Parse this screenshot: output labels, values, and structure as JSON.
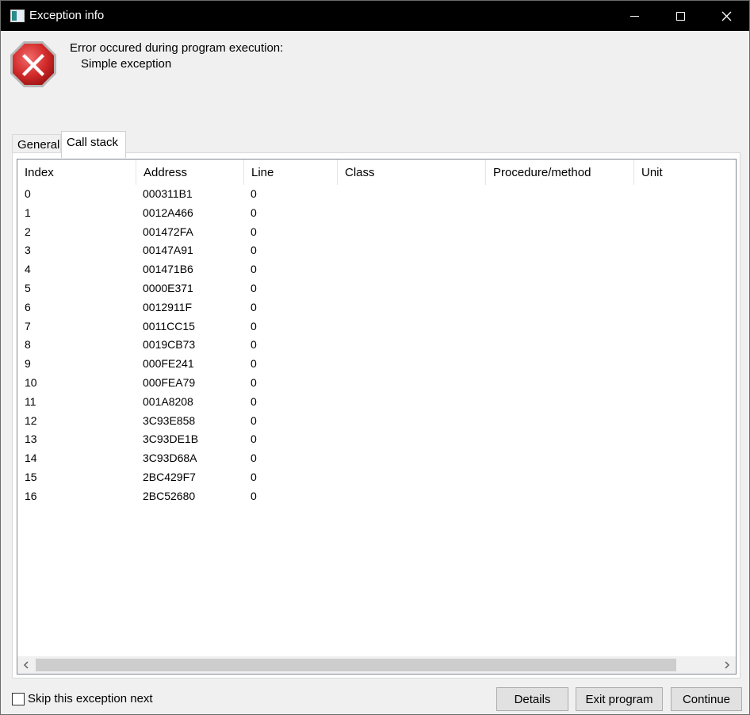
{
  "window": {
    "title": "Exception info",
    "icon": "app-window-icon",
    "controls": [
      "minimize-icon",
      "maximize-icon",
      "close-icon"
    ]
  },
  "message": {
    "icon": "error-icon",
    "line1": "Error occured during program execution:",
    "line2": "Simple exception"
  },
  "tabs": [
    {
      "label": "General",
      "active": false
    },
    {
      "label": "Call stack",
      "active": true
    }
  ],
  "table": {
    "columns": [
      "Index",
      "Address",
      "Line",
      "Class",
      "Procedure/method",
      "Unit"
    ],
    "rows": [
      [
        "0",
        "000311B1",
        "0"
      ],
      [
        "1",
        "0012A466",
        "0"
      ],
      [
        "2",
        "001472FA",
        "0"
      ],
      [
        "3",
        "00147A91",
        "0"
      ],
      [
        "4",
        "001471B6",
        "0"
      ],
      [
        "5",
        "0000E371",
        "0"
      ],
      [
        "6",
        "0012911F",
        "0"
      ],
      [
        "7",
        "0011CC15",
        "0"
      ],
      [
        "8",
        "0019CB73",
        "0"
      ],
      [
        "9",
        "000FE241",
        "0"
      ],
      [
        "10",
        "000FEA79",
        "0"
      ],
      [
        "11",
        "001A8208",
        "0"
      ],
      [
        "12",
        "3C93E858",
        "0"
      ],
      [
        "13",
        "3C93DE1B",
        "0"
      ],
      [
        "14",
        "3C93D68A",
        "0"
      ],
      [
        "15",
        "2BC429F7",
        "0"
      ],
      [
        "16",
        "2BC52680",
        "0"
      ]
    ]
  },
  "footer": {
    "skip_label": "Skip this exception next",
    "skip_checked": false,
    "buttons": {
      "details": "Details",
      "exit": "Exit program",
      "continue": "Continue"
    }
  },
  "colors": {
    "titlebar": "#000000",
    "error_red": "#d32b2b",
    "button_face": "#e1e1e1"
  }
}
